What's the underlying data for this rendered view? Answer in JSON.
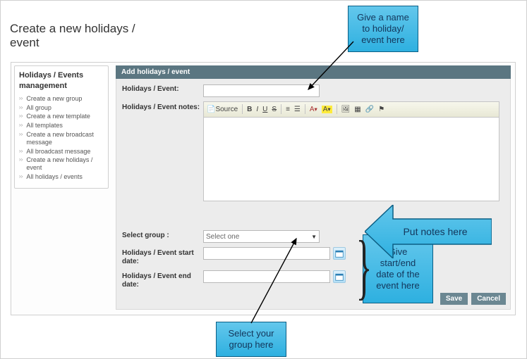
{
  "page": {
    "title": "Create a new holidays / event"
  },
  "panel_header": "Add holidays / event",
  "sidebar": {
    "title": "Holidays / Events management",
    "items": [
      {
        "label": "Create a new group"
      },
      {
        "label": "All group"
      },
      {
        "label": "Create a new template"
      },
      {
        "label": "All templates"
      },
      {
        "label": "Create a new broadcast message"
      },
      {
        "label": "All broadcast message"
      },
      {
        "label": "Create a new holidays / event"
      },
      {
        "label": "All holidays / events"
      }
    ]
  },
  "form": {
    "event_label": "Holidays / Event:",
    "event_value": "",
    "notes_label": "Holidays / Event notes:",
    "notes_value": "",
    "group_label": "Select group :",
    "group_selected": "Select one",
    "start_label": "Holidays / Event start date:",
    "start_value": "",
    "end_label": "Holidays / Event end date:",
    "end_value": "",
    "toolbar": {
      "source": "Source",
      "bold": "B",
      "italic": "I",
      "underline": "U"
    }
  },
  "buttons": {
    "save": "Save",
    "cancel": "Cancel"
  },
  "callouts": {
    "name": "Give a name to holiday/ event here",
    "notes": "Put notes here",
    "dates": "Give start/end date of the event here",
    "group": "Select your group here"
  }
}
